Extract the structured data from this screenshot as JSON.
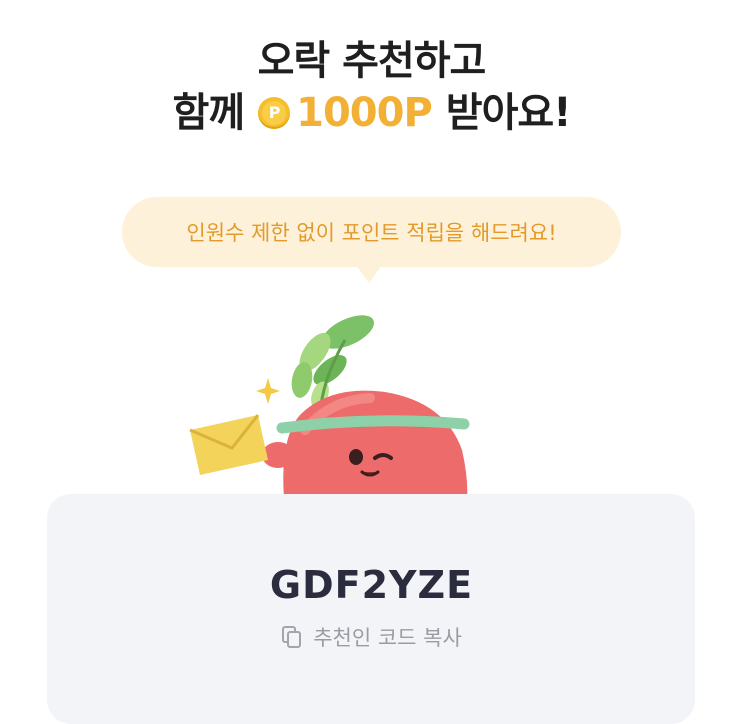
{
  "headline": {
    "line1": "오락 추천하고",
    "line2_prefix": "함께",
    "coin_letter": "P",
    "points": "1000P",
    "line2_suffix": "받아요!"
  },
  "bubble": {
    "text": "인원수 제한 없이 포인트 적립을 해드려요!"
  },
  "referral": {
    "code": "GDF2YZE",
    "copy_label": "추천인 코드 복사"
  },
  "icons": {
    "coin": "point-coin-icon",
    "copy": "copy-icon",
    "mascot": "radish-mascot-with-envelope"
  },
  "colors": {
    "points_accent": "#f2b136",
    "bubble_bg": "#fdf2d9",
    "bubble_text": "#e49a2a",
    "card_bg": "#f3f4f8"
  }
}
